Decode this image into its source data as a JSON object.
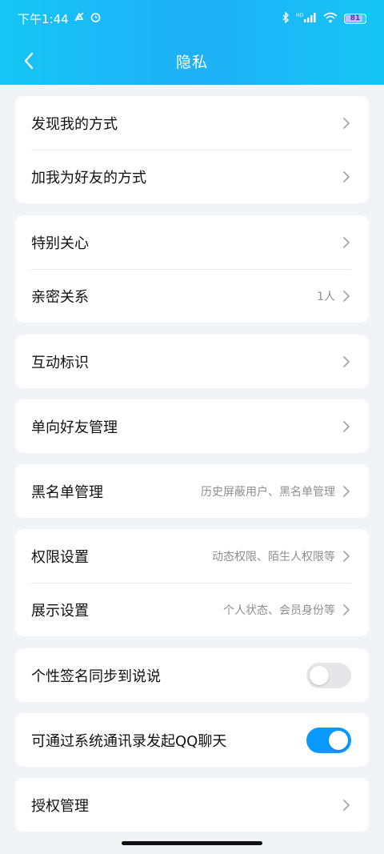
{
  "status_bar": {
    "time": "下午1:44",
    "network": "HD",
    "battery_level": "81"
  },
  "header": {
    "title": "隐私"
  },
  "sections": [
    {
      "items": [
        {
          "label": "发现我的方式"
        },
        {
          "label": "加我为好友的方式"
        }
      ]
    },
    {
      "items": [
        {
          "label": "特别关心"
        },
        {
          "label": "亲密关系",
          "value": "1人"
        }
      ]
    },
    {
      "items": [
        {
          "label": "互动标识"
        }
      ]
    },
    {
      "items": [
        {
          "label": "单向好友管理"
        }
      ]
    },
    {
      "items": [
        {
          "label": "黑名单管理",
          "value": "历史屏蔽用户、黑名单管理"
        }
      ]
    },
    {
      "items": [
        {
          "label": "权限设置",
          "value": "动态权限、陌生人权限等"
        },
        {
          "label": "展示设置",
          "value": "个人状态、会员身份等"
        }
      ]
    },
    {
      "items": [
        {
          "label": "个性签名同步到说说",
          "toggle": "off"
        }
      ]
    },
    {
      "items": [
        {
          "label": "可通过系统通讯录发起QQ聊天",
          "toggle": "on"
        }
      ]
    },
    {
      "items": [
        {
          "label": "授权管理"
        }
      ]
    }
  ],
  "colors": {
    "header_start": "#15c6f4",
    "header_end": "#1fb0f7",
    "toggle_on": "#0a99ff",
    "toggle_off": "#e6e6ea",
    "background": "#f2f3f7"
  },
  "icons": {
    "back": "chevron-left-icon",
    "row_arrow": "chevron-right-icon"
  }
}
